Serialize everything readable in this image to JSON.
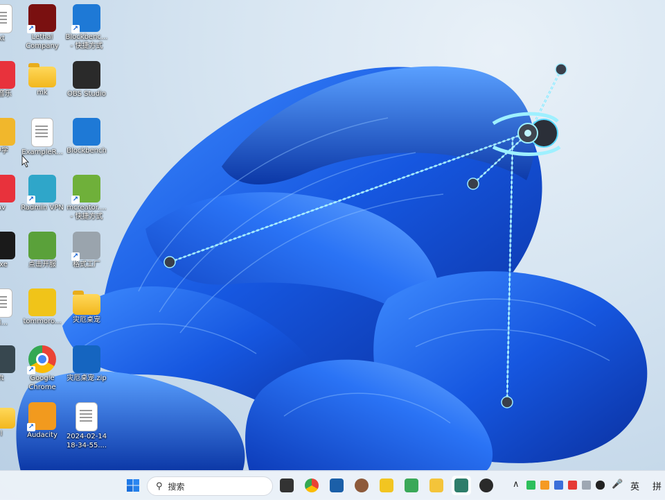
{
  "desktop": {
    "icons": [
      {
        "id": "partial-txt",
        "label": "xt",
        "kind": "doc",
        "shortcut": false
      },
      {
        "id": "lethal-company",
        "label": "Lethal\nCompany",
        "kind": "app",
        "color": "#7a1010",
        "shortcut": true
      },
      {
        "id": "blockbench-shortcut",
        "label": "Blockbenc...\n- 快捷方式",
        "kind": "app",
        "color": "#1e79d6",
        "shortcut": true
      },
      {
        "id": "netease-music",
        "label": "云音乐",
        "kind": "app",
        "color": "#e8323c",
        "shortcut": false
      },
      {
        "id": "mk-folder",
        "label": "mk",
        "kind": "folder",
        "shortcut": false
      },
      {
        "id": "obs-studio",
        "label": "OBS Studio",
        "kind": "app",
        "color": "#2a2a2a",
        "shortcut": false
      },
      {
        "id": "partial-school",
        "label": "中学",
        "kind": "app",
        "color": "#f1b72c",
        "shortcut": false
      },
      {
        "id": "example-file",
        "label": "ExampleR...",
        "kind": "doc",
        "shortcut": false
      },
      {
        "id": "blockbench",
        "label": "Blockbench",
        "kind": "app",
        "color": "#1e79d6",
        "shortcut": false
      },
      {
        "id": "partial-av",
        "label": "av",
        "kind": "app",
        "color": "#e8323c",
        "shortcut": false
      },
      {
        "id": "radmin-vpn",
        "label": "Radmin VPN",
        "kind": "app",
        "color": "#2fa6c9",
        "shortcut": true
      },
      {
        "id": "mcreator",
        "label": "mcreator....\n- 快捷方式",
        "kind": "app",
        "color": "#6fb03a",
        "shortcut": true
      },
      {
        "id": "partial-exe",
        "label": "exe",
        "kind": "app",
        "color": "#1a1a1a",
        "shortcut": false
      },
      {
        "id": "start-server",
        "label": "点击开服",
        "kind": "app",
        "color": "#5aa13a",
        "shortcut": false
      },
      {
        "id": "format-factory",
        "label": "格式工厂",
        "kind": "app",
        "color": "#9aa4ad",
        "shortcut": true
      },
      {
        "id": "partial-m",
        "label": "M...",
        "kind": "doc",
        "shortcut": false
      },
      {
        "id": "tommoro",
        "label": "tommoro...",
        "kind": "app",
        "color": "#f0c419",
        "shortcut": false
      },
      {
        "id": "pet-folder",
        "label": "灾厄桌宠",
        "kind": "folder",
        "shortcut": false
      },
      {
        "id": "partial-ft",
        "label": "ft",
        "kind": "app",
        "color": "#37474f",
        "shortcut": false
      },
      {
        "id": "google-chrome",
        "label": "Google\nChrome",
        "kind": "chrome",
        "shortcut": true
      },
      {
        "id": "pet-zip",
        "label": "灾厄桌宠.zip",
        "kind": "app",
        "color": "#1565c0",
        "shortcut": false
      },
      {
        "id": "partial-folder",
        "label": "l",
        "kind": "folder",
        "shortcut": false
      },
      {
        "id": "audacity",
        "label": "Audacity",
        "kind": "app",
        "color": "#f29a1e",
        "shortcut": true
      },
      {
        "id": "video-file",
        "label": "2024-02-14\n18-34-55....",
        "kind": "doc",
        "shortcut": false
      }
    ]
  },
  "taskbar": {
    "search_placeholder": "搜索",
    "pinned": [
      {
        "id": "task-view",
        "color": "#333333"
      },
      {
        "id": "chrome",
        "color": "#4285f4"
      },
      {
        "id": "pycharm",
        "color": "#1b5fa8"
      },
      {
        "id": "minecraft-head",
        "color": "#8d5a3b"
      },
      {
        "id": "app-yellow",
        "color": "#f2c521"
      },
      {
        "id": "app-leaf",
        "color": "#3aa858"
      },
      {
        "id": "file-explorer",
        "color": "#f4c43a"
      },
      {
        "id": "active-app",
        "color": "#2e7d6a"
      },
      {
        "id": "obs-app",
        "color": "#2a2a2a"
      }
    ],
    "tray": {
      "input_lang": "英",
      "ime_mode": "拼"
    }
  },
  "colors": {
    "wallpaper_blue": "#1a5fe0",
    "beam": "#7fe6ff"
  }
}
